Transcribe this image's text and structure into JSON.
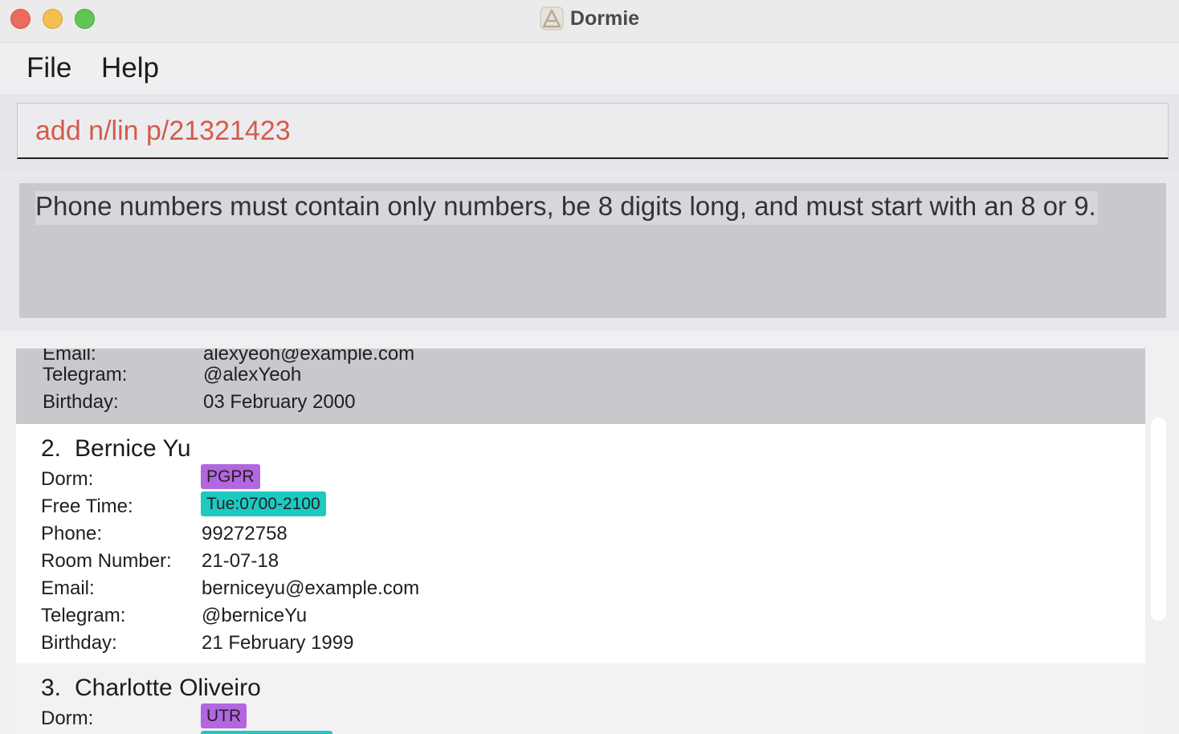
{
  "window": {
    "title": "Dormie"
  },
  "menu": {
    "file": "File",
    "help": "Help"
  },
  "command": {
    "value": "add n/lin p/21321423"
  },
  "result": {
    "message": "Phone numbers must contain only numbers, be 8 digits long, and must start with an 8 or 9."
  },
  "labels": {
    "dorm": "Dorm:",
    "free_time": "Free Time:",
    "phone": "Phone:",
    "room": "Room Number:",
    "email": "Email:",
    "telegram": "Telegram:",
    "birthday": "Birthday:"
  },
  "persons": [
    {
      "email": "alexyeoh@example.com",
      "telegram": "@alexYeoh",
      "birthday": "03 February 2000"
    },
    {
      "index": "2.",
      "name": "Bernice Yu",
      "dorm": "PGPR",
      "free_time": "Tue:0700-2100",
      "phone": "99272758",
      "room": "21-07-18",
      "email": "berniceyu@example.com",
      "telegram": "@berniceYu",
      "birthday": "21 February 1999"
    },
    {
      "index": "3.",
      "name": "Charlotte Oliveiro",
      "dorm": "UTR"
    }
  ],
  "colors": {
    "command_text": "#d35c4b",
    "selected_card": "#c8c8cd",
    "dorm_tag": "#b266e0",
    "free_time_tag": "#1ec9c2"
  }
}
